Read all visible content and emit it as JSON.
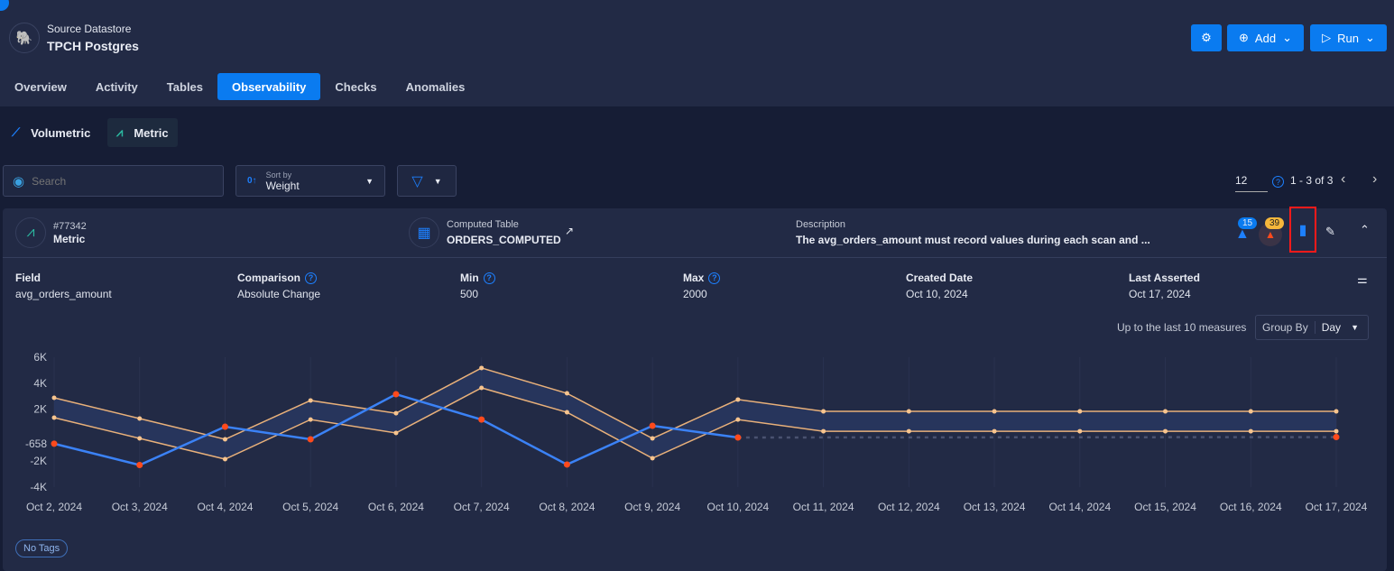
{
  "header": {
    "datastore_label": "Source Datastore",
    "datastore_name": "TPCH Postgres",
    "add_label": "Add",
    "run_label": "Run"
  },
  "tabs": [
    {
      "label": "Overview"
    },
    {
      "label": "Activity"
    },
    {
      "label": "Tables"
    },
    {
      "label": "Observability",
      "active": true
    },
    {
      "label": "Checks"
    },
    {
      "label": "Anomalies"
    }
  ],
  "subtabs": {
    "volumetric": "Volumetric",
    "metric": "Metric"
  },
  "toolbar": {
    "search_placeholder": "Search",
    "sort_label": "Sort by",
    "sort_value": "Weight",
    "page_size": "12",
    "range": "1 - 3 of 3"
  },
  "check": {
    "id": "#77342",
    "type": "Metric",
    "table_label": "Computed Table",
    "table_name": "ORDERS_COMPUTED",
    "description_label": "Description",
    "description": "The avg_orders_amount must record values during each scan and ...",
    "badge_active": "15",
    "badge_anomalies": "39",
    "fields": [
      {
        "label": "Field",
        "value": "avg_orders_amount"
      },
      {
        "label": "Comparison",
        "value": "Absolute Change",
        "help": true
      },
      {
        "label": "Min",
        "value": "500",
        "help": true
      },
      {
        "label": "Max",
        "value": "2000",
        "help": true
      },
      {
        "label": "Created Date",
        "value": "Oct 10, 2024"
      },
      {
        "label": "Last Asserted",
        "value": "Oct 17, 2024"
      }
    ],
    "measures_note": "Up to the last 10 measures",
    "group_by_label": "Group By",
    "group_by_value": "Day",
    "tags": "No Tags"
  },
  "colors": {
    "accent": "#0a7bf0",
    "actual": "#3b82f6",
    "band": "#e8b07a",
    "anomaly": "#ff4a1c"
  },
  "chart_data": {
    "type": "line",
    "categories": [
      "Oct 2, 2024",
      "Oct 3, 2024",
      "Oct 4, 2024",
      "Oct 5, 2024",
      "Oct 6, 2024",
      "Oct 7, 2024",
      "Oct 8, 2024",
      "Oct 9, 2024",
      "Oct 10, 2024",
      "Oct 11, 2024",
      "Oct 12, 2024",
      "Oct 13, 2024",
      "Oct 14, 2024",
      "Oct 15, 2024",
      "Oct 16, 2024",
      "Oct 17, 2024"
    ],
    "yticks": [
      {
        "v": 6000,
        "label": "6K"
      },
      {
        "v": 4000,
        "label": "4K"
      },
      {
        "v": 2000,
        "label": "2K"
      },
      {
        "v": -658,
        "label": "-658"
      },
      {
        "v": -2000,
        "label": "-2K"
      },
      {
        "v": -4000,
        "label": "-4K"
      }
    ],
    "ylim": [
      -4000,
      6000
    ],
    "actual": [
      -658,
      -2300,
      650,
      -320,
      3150,
      1200,
      -2260,
      720,
      -180,
      null,
      null,
      null,
      null,
      null,
      null,
      null
    ],
    "projected": {
      "from": "Oct 10, 2024",
      "to": "Oct 17, 2024",
      "value": -150
    },
    "upper": [
      2875,
      1280,
      -320,
      2670,
      1690,
      5170,
      3220,
      -250,
      2740,
      1830,
      1830,
      1830,
      1830,
      1830,
      1830,
      1830
    ],
    "lower": [
      1350,
      -250,
      -1850,
      1200,
      170,
      3640,
      1760,
      -1780,
      1200,
      300,
      300,
      300,
      300,
      300,
      300,
      300
    ],
    "anomalies": [
      "Oct 2, 2024",
      "Oct 3, 2024",
      "Oct 4, 2024",
      "Oct 5, 2024",
      "Oct 6, 2024",
      "Oct 7, 2024",
      "Oct 8, 2024",
      "Oct 9, 2024",
      "Oct 10, 2024",
      "Oct 17, 2024"
    ],
    "grid": "vertical"
  }
}
